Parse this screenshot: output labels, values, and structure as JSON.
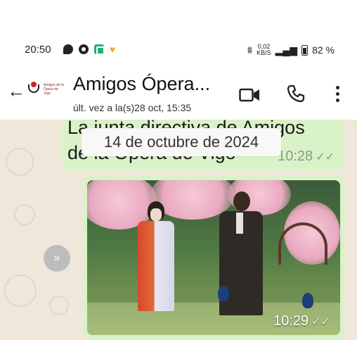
{
  "status_bar": {
    "time": "20:50",
    "data_speed": "0,02",
    "data_unit": "KB/S",
    "battery": "82 %",
    "icons": [
      "chat-bubble-icon",
      "dnd-circle-icon",
      "green-app-icon",
      "heart-icon",
      "vibrate-icon",
      "wifi-signal-icon",
      "battery-icon"
    ]
  },
  "header": {
    "title": "Amigos Ópera...",
    "subtitle": "últ. vez a la(s)28 oct, 15:35",
    "avatar_text": "Amigos de la Ópera de Vigo"
  },
  "chat": {
    "date_chip": "14 de octubre de 2024",
    "text_message": {
      "line1": "La junta directiva de Amigos",
      "line2": "de la Ópera de Vigo",
      "time": "10:28",
      "ticks": "✓✓"
    },
    "photo_message": {
      "time": "10:29",
      "ticks": "✓✓"
    },
    "forward_glyph": "»"
  },
  "colors": {
    "chat_background": "#efe7d9",
    "outgoing_bubble": "#d9f2c7",
    "date_chip_bg": "#f8f8f6"
  }
}
